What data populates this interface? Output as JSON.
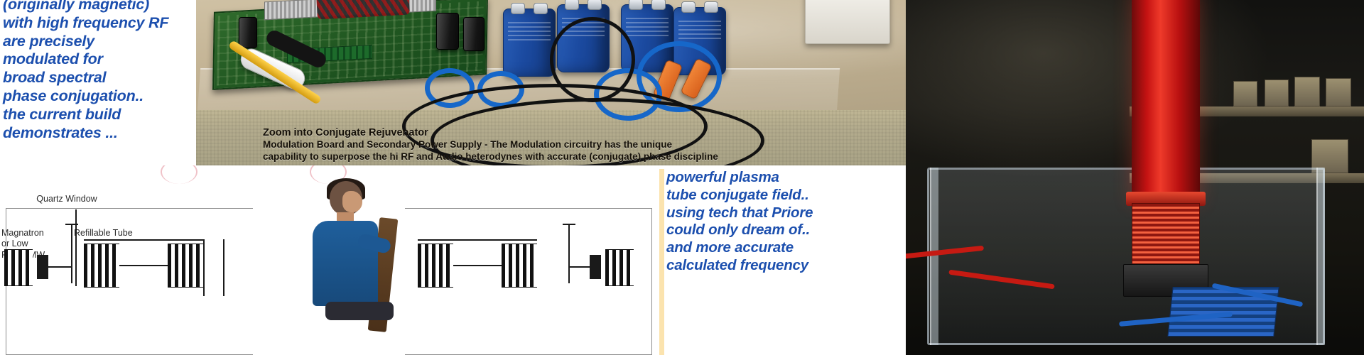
{
  "left_note": {
    "lines": [
      "(originally magnetic)",
      "with high frequency RF",
      "are precisely",
      "modulated for",
      "broad spectral",
      "phase conjugation..",
      "the current build",
      "demonstrates ..."
    ],
    "color": "#1c4fae"
  },
  "board_photo": {
    "caption": {
      "line1": "Zoom into Conjugate Rejuvenator",
      "line2": "Modulation Board and Secondary Power Supply -  The Modulation circuitry has the unique",
      "line3": "capability to superpose the hi RF and Audio heterodynes with accurate (conjugate) phase discipline"
    },
    "alt": "Close-up photograph of a green circuit board with aluminium heatsink, blue high-voltage capacitors, black electrolytic capacitors, orange insulated leads and blue and black interconnect cabling resting on a clear acrylic sheet over a beige mat."
  },
  "coil_photo": {
    "alt": "Night photograph of a large red-wound Tesla-style secondary coil standing on a black base inside a clear acrylic support frame, with red and blue primary leads and blue capacitors visible below."
  },
  "schematic": {
    "labels": [
      {
        "id": "quartz-window",
        "text": "Quartz Window"
      },
      {
        "id": "magnatron",
        "text": "Magnatron\nor Low\nPower MW"
      },
      {
        "id": "refillable-tube",
        "text": "Refillable Tube"
      }
    ],
    "alt": "Line schematic of a plasma tube apparatus with a magnetron or low-power microwave source feeding a refillable tube behind a quartz window, shown beside a seated operator."
  },
  "right_note": {
    "lines": [
      "powerful plasma",
      "tube conjugate field..",
      "using tech that Priore",
      "could only dream of..",
      "and more accurate",
      "calculated frequency"
    ],
    "color": "#1c4fae",
    "rule_color": "#fbe3ae"
  }
}
